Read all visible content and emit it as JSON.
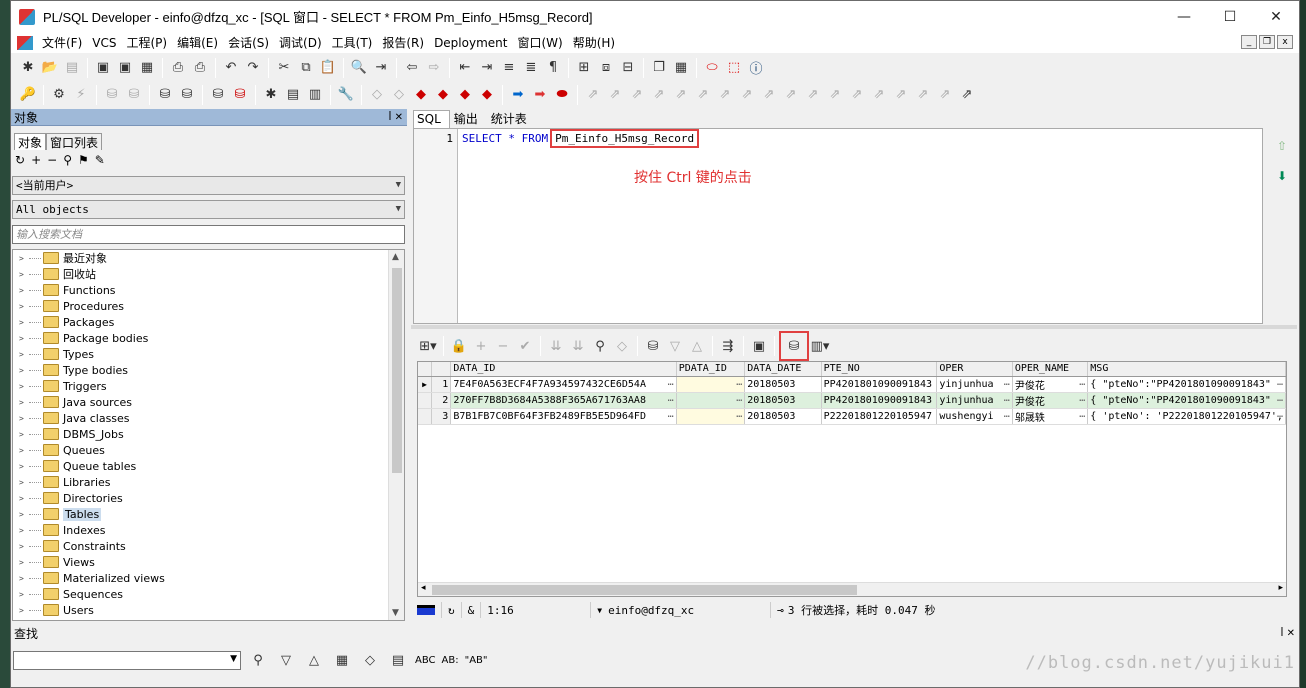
{
  "window": {
    "title": "PL/SQL Developer - einfo@dfzq_xc - [SQL 窗口 - SELECT * FROM Pm_Einfo_H5msg_Record]",
    "minimize": "—",
    "maximize": "☐",
    "close": "✕"
  },
  "menu": [
    "文件(F)",
    "VCS",
    "工程(P)",
    "编辑(E)",
    "会话(S)",
    "调试(D)",
    "工具(T)",
    "报告(R)",
    "Deployment",
    "窗口(W)",
    "帮助(H)"
  ],
  "left": {
    "panel_title": "对象",
    "pin": "ꟾ ✕",
    "tabs": [
      "对象",
      "窗口列表"
    ],
    "user_combo": "<当前用户>",
    "type_combo": "All objects",
    "search_placeholder": "输入搜索文档",
    "tree": [
      "最近对象",
      "回收站",
      "Functions",
      "Procedures",
      "Packages",
      "Package bodies",
      "Types",
      "Type bodies",
      "Triggers",
      "Java sources",
      "Java classes",
      "DBMS_Jobs",
      "Queues",
      "Queue tables",
      "Libraries",
      "Directories",
      "Tables",
      "Indexes",
      "Constraints",
      "Views",
      "Materialized views",
      "Sequences",
      "Users"
    ],
    "selected": "Tables"
  },
  "editor": {
    "tabs": [
      "SQL",
      "输出",
      "统计表"
    ],
    "line_no": "1",
    "code_prefix": "SELECT * FROM",
    "code_table": "Pm_Einfo_H5msg_Record",
    "annotation": "按住 Ctrl 键的点击"
  },
  "grid": {
    "columns": [
      "DATA_ID",
      "PDATA_ID",
      "DATA_DATE",
      "PTE_NO",
      "OPER",
      "OPER_NAME",
      "MSG"
    ],
    "rows": [
      {
        "n": "1",
        "cells": [
          "7E4F0A563ECF4F7A934597432CE6D54A",
          "",
          "20180503",
          "PP4201801090091843",
          "yinjunhua",
          "尹俊花",
          "{   \"pteNo\":\"PP4201801090091843\""
        ]
      },
      {
        "n": "2",
        "cells": [
          "270FF7B8D3684A5388F365A671763AA8",
          "",
          "20180503",
          "PP4201801090091843",
          "yinjunhua",
          "尹俊花",
          "{   \"pteNo\":\"PP4201801090091843\""
        ]
      },
      {
        "n": "3",
        "cells": [
          "B7B1FB7C0BF64F3FB2489FB5E5D964FD",
          "",
          "20180503",
          "P22201801220105947",
          "wushengyi",
          "邬晟轶",
          "{ 'pteNo': 'P22201801220105947',"
        ]
      }
    ],
    "ellipsis": "…"
  },
  "status": {
    "pos": "1:16",
    "conn": "einfo@dfzq_xc",
    "result": "3 行被选择，耗时 0.047 秒"
  },
  "find": {
    "title": "查找",
    "abc1": "ABC",
    "abc2": "AB:",
    "abc3": "\"AB\""
  },
  "watermark": "//blog.csdn.net/yujikui1"
}
